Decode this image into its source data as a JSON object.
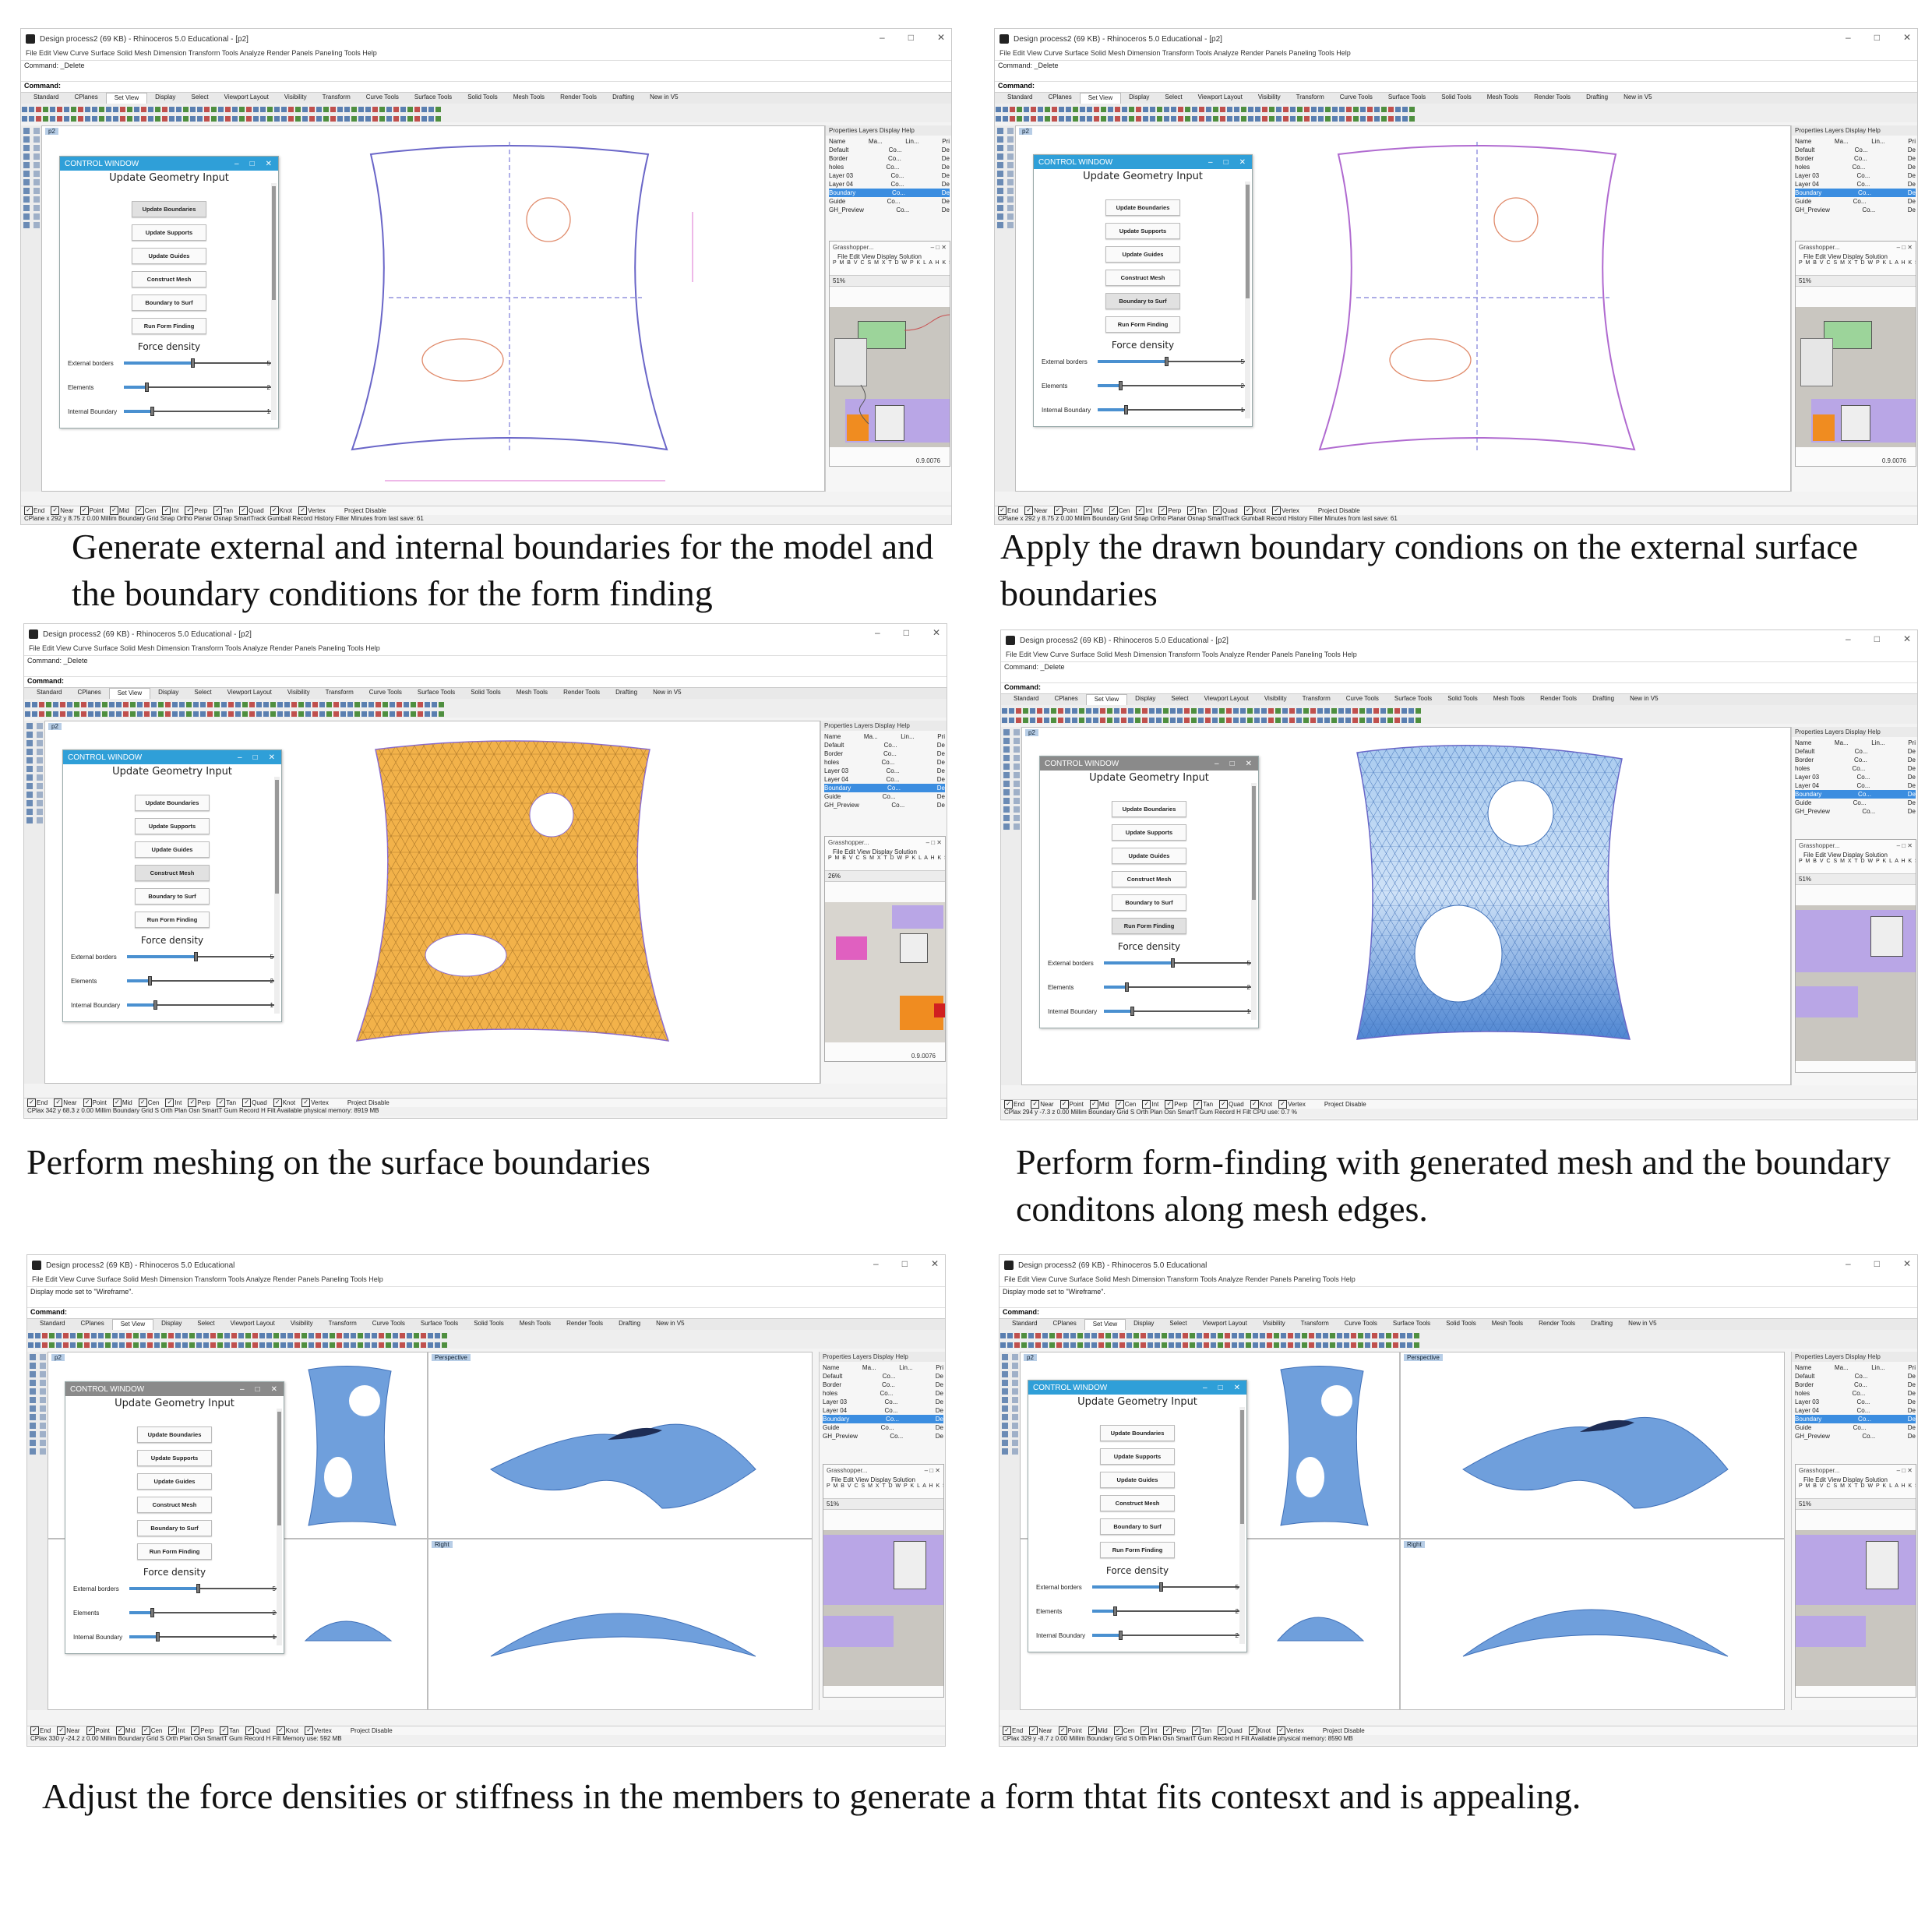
{
  "app": {
    "window_title": "Design process2 (69 KB) - Rhinoceros 5.0 Educational - [p2]",
    "window_title_short": "Design process2 (69 KB) - Rhinoceros 5.0 Educational",
    "menu": "File  Edit  View  Curve  Surface  Solid  Mesh  Dimension  Transform  Tools  Analyze  Render  Panels  Paneling Tools  Help",
    "cmd_history_delete": "Command: _Delete",
    "cmd_history_wire": "Display mode set to \"Wireframe\".",
    "command_label": "Command:",
    "tabs": [
      "Standard",
      "CPlanes",
      "Set View",
      "Display",
      "Select",
      "Viewport Layout",
      "Visibility",
      "Transform",
      "Curve Tools",
      "Surface Tools",
      "Solid Tools",
      "Mesh Tools",
      "Render Tools",
      "Drafting",
      "New in V5"
    ],
    "viewport_top": "p2",
    "viewport_persp": "Perspective",
    "viewport_right": "Right",
    "panel_tabs": "Properties  Layers  Display  Help",
    "layer_header": [
      "Name",
      "Ma...",
      "Lin...",
      "Pri"
    ],
    "layers": [
      "Default",
      "Border",
      "holes",
      "Layer 03",
      "Layer 04",
      "Boundary",
      "Guide",
      "GH_Preview"
    ],
    "layer_mat": "Co...",
    "layer_pri": "De",
    "gh_title": "Grasshopper...",
    "gh_menu": "File   Edit   View   Display   Solution",
    "gh_components": "P M B V C S M X T D W P K L A H K S T",
    "gh_zoom_a": "51%",
    "gh_zoom_b": "26%",
    "gh_version": "0.9.0076",
    "osnap": [
      "End",
      "Near",
      "Point",
      "Mid",
      "Cen",
      "Int",
      "Perp",
      "Tan",
      "Quad",
      "Knot",
      "Vertex"
    ],
    "osnap_extra": "Project    Disable",
    "status": {
      "s1": "CPlane  x 292  y 8.75  z 0.00  Millim   Boundary  Grid Snap  Ortho  Planar  Osnap  SmartTrack  Gumball  Record History  Filter  Minutes from last save: 61",
      "s2": "CPlane  x 292  y 8.75  z 0.00  Millim   Boundary  Grid Snap  Ortho  Planar  Osnap  SmartTrack  Gumball  Record History  Filter  Minutes from last save: 61",
      "s3": "CPlax 342  y 68.3 z 0.00 Millim    Boundary  Grid S Orth Plan Osn SmartT Gum Record H Filt Available physical memory: 8919 MB",
      "s4": "CPlax 294  y -7.3 z 0.00 Millim    Boundary  Grid S Orth Plan Osn SmartT Gum Record H Filt CPU use: 0.7 %",
      "s5": "CPlax 330  y -24.2 z 0.00 Millim   Boundary  Grid S Orth Plan Osn SmartT Gum Record H Filt Memory use: 592 MB",
      "s6": "CPlax 329  y -8.7 z 0.00 Millim    Boundary  Grid S Orth Plan Osn SmartT Gum Record H Filt Available physical memory: 8590 MB"
    }
  },
  "control_window": {
    "title": "CONTROL WINDOW",
    "heading": "Update Geometry Input",
    "buttons": [
      "Update Boundaries",
      "Update Supports",
      "Update Guides",
      "Construct Mesh",
      "Boundary to Surf",
      "Run Form Finding"
    ],
    "force_density_label": "Force density",
    "sliders": [
      {
        "label": "External borders",
        "value": "5"
      },
      {
        "label": "Elements",
        "value": "2"
      },
      {
        "label": "Internal Boundary",
        "value": "1"
      }
    ],
    "internal_boundary_alt": "2",
    "header_color_active": "#2f9fd8",
    "header_color_inactive": "#8a8a8a"
  },
  "captions": {
    "c1": "Generate external and internal boundaries for the model and the boundary conditions for the form finding",
    "c2": "Apply the drawn boundary condions on the external surface boundaries",
    "c3": "Perform meshing on the surface boundaries",
    "c4": "Perform form-finding with generated mesh and the boundary conditons along mesh edges.",
    "c5": "Adjust the force densities or stiffness in the members to generate a form thtat fits contesxt and is appealing."
  },
  "colors": {
    "boundary": "#6a66c8",
    "support": "#e08a6a",
    "mesh_fill": "#f2b24a",
    "shell_blue": "#5d93d8",
    "gh_purple": "#b9a6e6",
    "gh_orange": "#f08c20"
  }
}
